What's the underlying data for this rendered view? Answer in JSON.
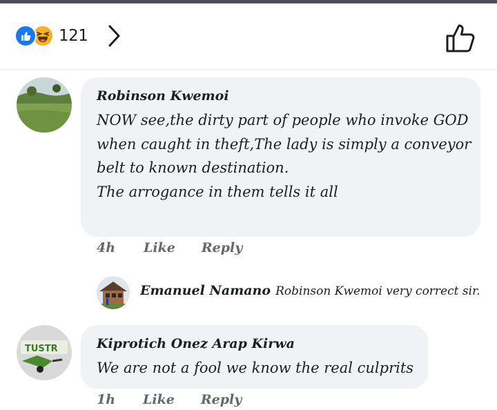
{
  "header": {
    "reaction_count": "121",
    "reactions": [
      "like-reaction",
      "haha-reaction"
    ],
    "icons": {
      "chevron": "chevron-right-icon",
      "like": "thumbs-up-icon"
    }
  },
  "comments": [
    {
      "author": "Robinson Kwemoi",
      "text_lines": [
        "NOW see,the dirty part of people who invoke GOD",
        "when caught in theft,The lady is simply a conveyor",
        "belt to known destination.",
        "The arrogance in them tells it all"
      ],
      "time": "4h",
      "like": "Like",
      "reply": "Reply"
    },
    {
      "author": "Kiprotich Onez Arap Kirwa",
      "text_lines": [
        "We are not a fool we know the real culprits"
      ],
      "time": "1h",
      "like": "Like",
      "reply": "Reply"
    }
  ],
  "reply_preview": {
    "author": "Emanuel Namano",
    "text": "Robinson Kwemoi very correct sir."
  },
  "colors": {
    "bubble": "#f0f2f5",
    "secondary_text": "#65676b",
    "like_blue": "#1877f2",
    "haha_yellow": "#f7b125"
  }
}
